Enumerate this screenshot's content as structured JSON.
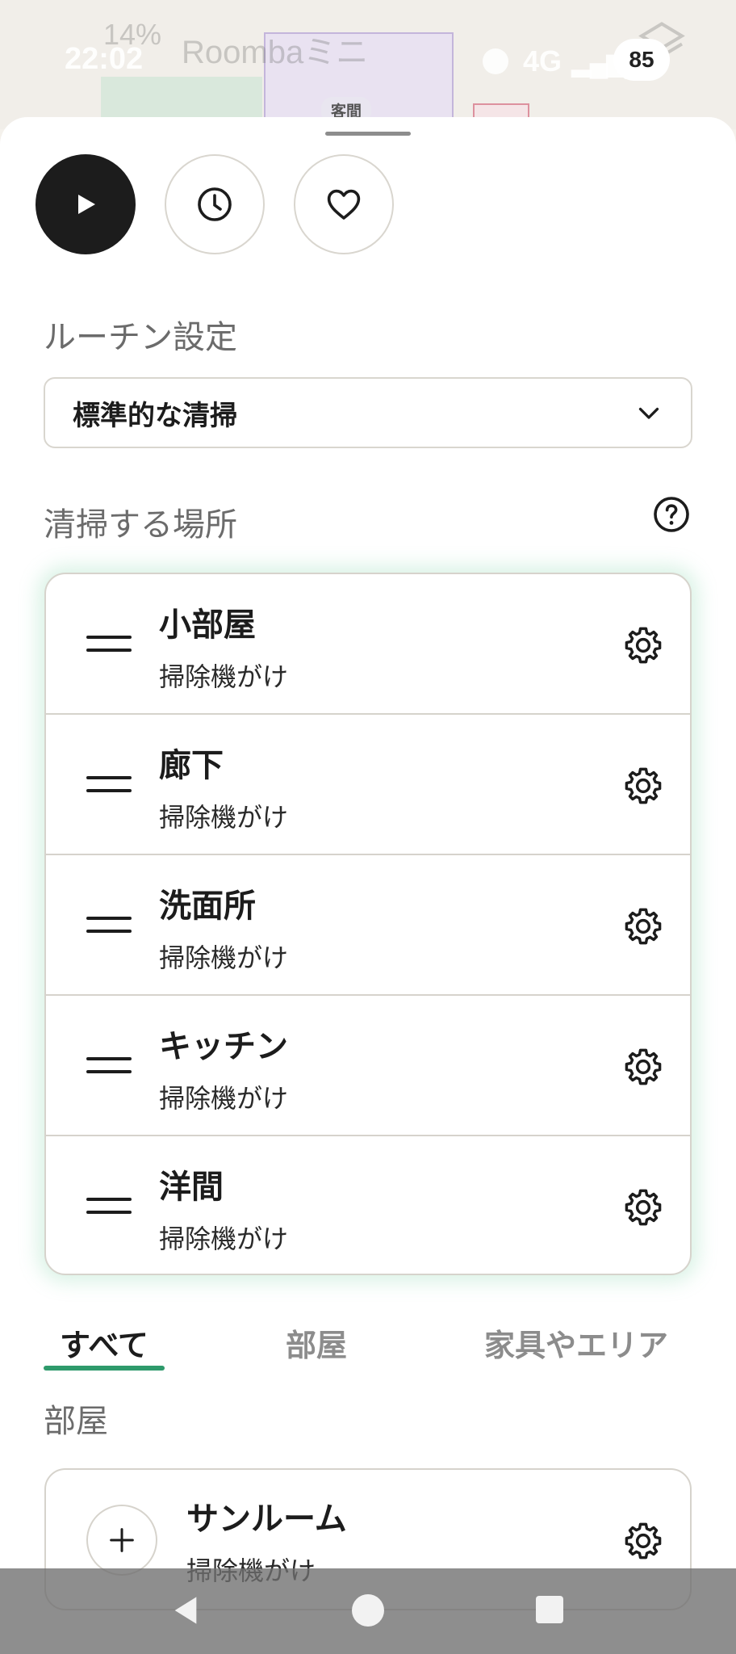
{
  "status_bar": {
    "time": "22:02",
    "battery_percent": "14%",
    "app_name": "Roombaミニ",
    "network": "4G",
    "badge": "85"
  },
  "map": {
    "room_label": "客間"
  },
  "actions": {
    "play": "play-icon",
    "schedule": "clock-icon",
    "favorite": "heart-icon"
  },
  "routine": {
    "title": "ルーチン設定",
    "selected": "標準的な清掃"
  },
  "places": {
    "title": "清掃する場所",
    "items": [
      {
        "name": "小部屋",
        "mode": "掃除機がけ"
      },
      {
        "name": "廊下",
        "mode": "掃除機がけ"
      },
      {
        "name": "洗面所",
        "mode": "掃除機がけ"
      },
      {
        "name": "キッチン",
        "mode": "掃除機がけ"
      },
      {
        "name": "洋間",
        "mode": "掃除機がけ"
      }
    ]
  },
  "tabs": [
    {
      "label": "すべて",
      "active": true
    },
    {
      "label": "部屋",
      "active": false
    },
    {
      "label": "家具やエリア",
      "active": false
    }
  ],
  "rooms": {
    "title": "部屋",
    "items": [
      {
        "name": "サンルーム",
        "mode": "掃除機がけ"
      }
    ]
  },
  "colors": {
    "accent": "#2e9a6b",
    "primary_button": "#1c1c1c"
  }
}
